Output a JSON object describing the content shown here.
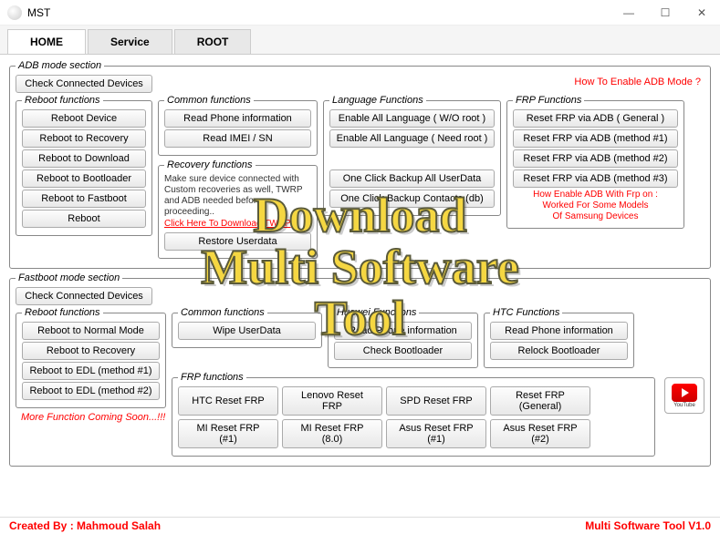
{
  "window": {
    "title": "MST"
  },
  "tabs": {
    "home": "HOME",
    "service": "Service",
    "root": "ROOT"
  },
  "adb": {
    "title": "ADB mode section",
    "check": "Check Connected Devices",
    "howto": "How To Enable ADB Mode ?",
    "reboot": {
      "title": "Reboot functions",
      "device": "Reboot Device",
      "recovery": "Reboot to Recovery",
      "download": "Reboot to Download",
      "bootloader": "Reboot to Bootloader",
      "fastboot": "Reboot to Fastboot",
      "reboot": "Reboot"
    },
    "common": {
      "title": "Common functions",
      "readphone": "Read Phone information",
      "readimei": "Read IMEI / SN",
      "restoredata": "Restore Userdata"
    },
    "recovery": {
      "title": "Recovery functions",
      "note1": "Make sure device connected with Custom recoveries as well, TWRP and ADB needed before proceeding..",
      "twrp": "Click Here To Download TWRP"
    },
    "language": {
      "title": "Language Functions",
      "wo": "Enable All Language ( W/O root )",
      "need": "Enable All Language ( Need root )",
      "backup": "One Click Backup All UserData",
      "contacts": "One Click Backup Contacts (db)"
    },
    "frp": {
      "title": "FRP Functions",
      "general": "Reset FRP via ADB ( General )",
      "m1": "Reset FRP via ADB (method #1)",
      "m2": "Reset FRP via ADB (method #2)",
      "m3": "Reset FRP via ADB (method #3)",
      "note": "How Enable ADB With Frp on :\nWorked For Some Models\nOf Samsung Devices"
    }
  },
  "fastboot": {
    "title": "Fastboot mode section",
    "check": "Check Connected Devices",
    "reboot": {
      "title": "Reboot functions",
      "normal": "Reboot to Normal Mode",
      "recovery": "Reboot to Recovery",
      "edl1": "Reboot to EDL  (method #1)",
      "edl2": "Reboot to EDL  (method #2)"
    },
    "common": {
      "title": "Common functions",
      "wipe": "Wipe UserData"
    },
    "huawei": {
      "title": "Huawei Functions",
      "read": "Read Phone information",
      "check": "Check Bootloader"
    },
    "htc": {
      "title": "HTC Functions",
      "read": "Read Phone information",
      "relock": "Relock Bootloader"
    },
    "frp": {
      "title": "FRP functions",
      "htc": "HTC Reset FRP",
      "lenovo": "Lenovo Reset FRP",
      "spd": "SPD Reset FRP",
      "general": "Reset FRP (General)",
      "mi1": "MI Reset FRP  (#1)",
      "mi8": "MI Reset FRP  (8.0)",
      "asus1": "Asus Reset FRP (#1)",
      "asus2": "Asus Reset FRP (#2)"
    },
    "soon": "More Function Coming Soon...!!!"
  },
  "footer": {
    "created": "Created By : Mahmoud Salah",
    "version": "Multi Software Tool V1.0"
  },
  "youtube": {
    "label": "YouTube"
  },
  "overlay": {
    "line1": "Download",
    "line2": "Multi Software",
    "line3": "Tool"
  }
}
